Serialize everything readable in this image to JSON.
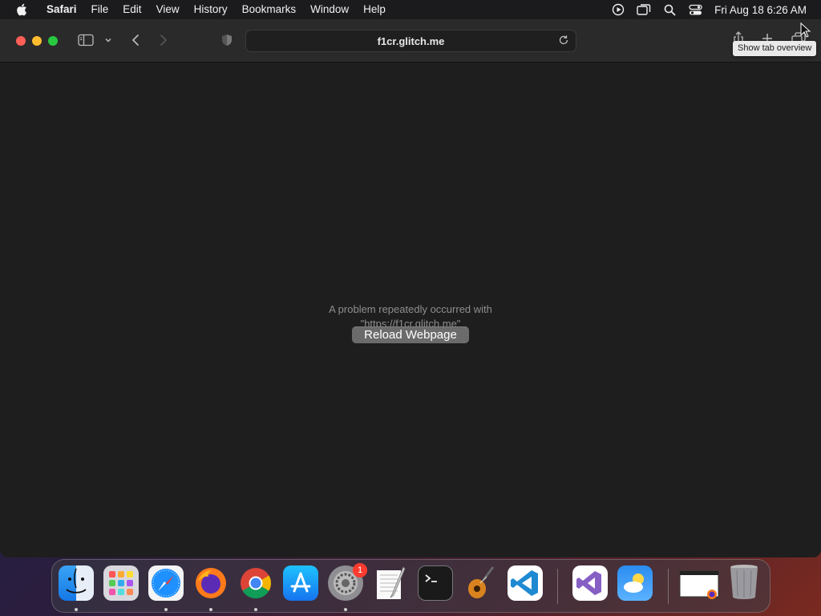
{
  "menubar": {
    "app_name": "Safari",
    "items": [
      "File",
      "Edit",
      "View",
      "History",
      "Bookmarks",
      "Window",
      "Help"
    ],
    "clock": "Fri Aug 18  6:26 AM",
    "status_icons": [
      "screen-recording-icon",
      "screen-mirroring-icon",
      "spotlight-search-icon",
      "control-center-icon"
    ]
  },
  "browser": {
    "url": "f1cr.glitch.me",
    "tooltip": "Show tab overview",
    "toolbar_icons": [
      "sidebar-icon",
      "chevron-down-icon",
      "back-icon",
      "forward-icon",
      "privacy-shield-icon",
      "share-icon",
      "new-tab-icon",
      "tab-overview-icon"
    ]
  },
  "page": {
    "error_line1": "A problem repeatedly occurred with",
    "error_line2": "\"https://f1cr.glitch.me\"",
    "reload_label": "Reload Webpage"
  },
  "dock": {
    "apps": [
      "Finder",
      "Launchpad",
      "Safari",
      "Firefox",
      "Chrome",
      "App Store",
      "System Settings",
      "TextEdit",
      "Terminal",
      "GarageBand",
      "Visual Studio Code",
      "Visual Studio",
      "Weather",
      "Downloads",
      "Trash"
    ],
    "settings_badge": "1"
  },
  "colors": {
    "close": "#ff5f57",
    "minimize": "#febc2e",
    "maximize": "#28c840",
    "badge": "#ff3b30"
  }
}
